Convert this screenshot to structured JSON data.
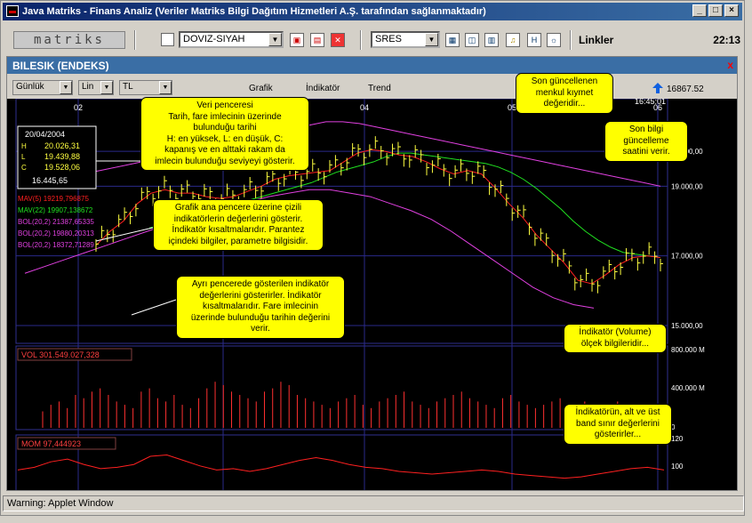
{
  "window": {
    "title": "Java Matriks - Finans Analiz (Veriler Matriks Bilgi Dağıtım Hizmetleri A.Ş. tarafından sağlanmaktadır)",
    "min": "_",
    "max": "□",
    "close": "×"
  },
  "toolbar": {
    "logo": "matriks",
    "currency": "DOVIZ-SIYAH",
    "symbol": "SRES",
    "links": "Linkler",
    "time": "22:13"
  },
  "panel": {
    "title": "BILESIK (ENDEKS)",
    "close": "x",
    "period": "Günlük",
    "scale": "Lin",
    "unit": "TL",
    "menus": [
      "Grafik",
      "İndikatör",
      "Trend"
    ],
    "last_value": "16867.52",
    "last_time": "16:45:01"
  },
  "info_box": {
    "date": "20/04/2004",
    "rows": [
      {
        "k": "H",
        "v": "20.026,31"
      },
      {
        "k": "L",
        "v": "19.439,88"
      },
      {
        "k": "C",
        "v": "19.528,06"
      }
    ],
    "volume": "16.445,65"
  },
  "indicators": [
    {
      "text": "MAV(5) 19219,796875",
      "color": "#ff2020"
    },
    {
      "text": "MAV(22) 19907,138672",
      "color": "#20e020"
    },
    {
      "text": "BOL(20,2) 21387,65335",
      "color": "#e040e0"
    },
    {
      "text": "BOL(20,2) 19880,20313",
      "color": "#e040e0"
    },
    {
      "text": "BOL(20,2) 18372,71289",
      "color": "#e040e0"
    }
  ],
  "vol_label": "VOL  301.549.027,328",
  "mom_label": "MOM 97,444923",
  "x_ticks": [
    "02",
    "03",
    "04",
    "05",
    "06"
  ],
  "price_axis": [
    "20.000,00",
    "19.000,00",
    "17.000,00",
    "15.000,00"
  ],
  "vol_axis": [
    "800.000 M",
    "400.000 M",
    "0"
  ],
  "mom_axis": [
    "120",
    "100",
    "70"
  ],
  "bubbles": {
    "data_window": "Veri penceresi\nTarih, fare imlecinin üzerinde\nbulunduğu tarihi\nH: en yüksek, L: en düşük, C:\nkapanış ve en alttaki rakam da\nimlecin bulunduğu seviyeyi gösterir.",
    "last_update": "Son güncellenen\nmenkul kıymet\ndeğeridir...",
    "last_time": "Son bilgi güncelleme\nsaatini verir.",
    "overlay": "Grafik ana pencere üzerine çizili\nindikatörlerin değerlerini gösterir.\nİndikatör kısaltmalarıdır. Parantez\niçindeki bilgiler, parametre bilgisidir.",
    "separate": "Ayrı pencerede gösterilen indikatör\ndeğerlerini gösterirler. İndikatör\nkısaltmalarıdır. Fare imlecinin\nüzerinde bulunduğu tarihin değerini\nverir.",
    "volume": "İndikatör (Volume)\nölçek bilgileridir...",
    "bands": "İndikatörün, alt ve üst\nband sınır değerlerini\ngösterirler..."
  },
  "status": "Warning: Applet Window",
  "chart_data": {
    "type": "line",
    "title": "BILESIK (ENDEKS)",
    "series": [
      {
        "name": "MAV(5)",
        "color": "#ff2020",
        "values": [
          17300,
          17700,
          18000,
          18500,
          18800,
          18900,
          18800,
          18800,
          18700,
          18650,
          18700,
          18850,
          19000,
          19200,
          19300,
          19350,
          19400,
          19450,
          19700,
          19950,
          20050,
          20000,
          19900,
          19850,
          19700,
          19500,
          19350,
          19450,
          19350,
          18950,
          18500,
          18100,
          17600,
          17200,
          16800,
          16300,
          16200,
          16450,
          16750,
          16950,
          17000,
          16950
        ]
      },
      {
        "name": "MAV(22)",
        "color": "#20e020",
        "values": [
          17800,
          17900,
          18000,
          18100,
          18200,
          18300,
          18400,
          18500,
          18600,
          18700,
          18800,
          18900,
          19000,
          19100,
          19250,
          19400,
          19500,
          19600,
          19700,
          19850,
          19950,
          19950,
          19900,
          19850,
          19800,
          19750,
          19700,
          19650,
          19550,
          19400,
          19200,
          18950,
          18650,
          18350,
          18000,
          17700,
          17450,
          17250,
          17100,
          17050,
          17000,
          16950
        ]
      },
      {
        "name": "BOL upper",
        "color": "#e040e0",
        "values": [
          19000,
          19100,
          19200,
          19300,
          19400,
          19500,
          19600,
          19700,
          19800,
          19900,
          20000,
          20100,
          20200,
          20300,
          20400,
          20500,
          20600,
          20750,
          20850,
          20850,
          20800,
          20700,
          20600,
          20500,
          20400,
          20300,
          20200,
          20100,
          20000,
          19900,
          19800,
          19700,
          19600,
          19500,
          19400,
          19300,
          19200,
          19100,
          19000
        ]
      },
      {
        "name": "BOL lower",
        "color": "#e040e0",
        "values": [
          16500,
          16700,
          16900,
          17100,
          17300,
          17500,
          17700,
          17900,
          18100,
          18250,
          18400,
          18550,
          18700,
          18800,
          18900,
          18900,
          18800,
          18700,
          18500,
          18300,
          18050,
          17700,
          17300,
          16900,
          16500,
          16100,
          15800,
          15600,
          15500
        ]
      },
      {
        "name": "MOM",
        "color": "#ff2020",
        "values": [
          97,
          99,
          103,
          105,
          101,
          98,
          99,
          101,
          107,
          108,
          104,
          100,
          97,
          98,
          96,
          98,
          101,
          104,
          106,
          104,
          101,
          99,
          98,
          96,
          95,
          94,
          95,
          96,
          97,
          96,
          94,
          93,
          92,
          91,
          92,
          94,
          96,
          98,
          99,
          97
        ]
      }
    ],
    "ylim": [
      15000,
      21000
    ]
  }
}
